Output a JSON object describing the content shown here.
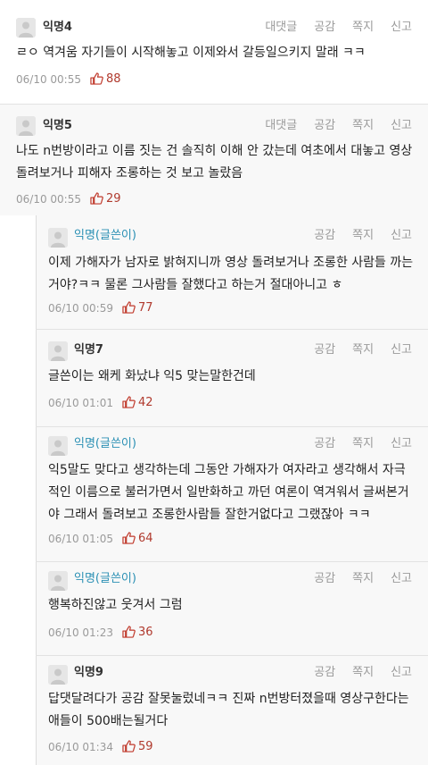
{
  "actions": {
    "reply": "대댓글",
    "like": "공감",
    "message": "쪽지",
    "report": "신고"
  },
  "colors": {
    "like": "#c0392b",
    "op_nick": "#2b90b4",
    "reply_bg": "#f8f8f8"
  },
  "icons": {
    "avatar": "default-avatar-icon",
    "like": "thumbs-up-icon"
  },
  "comments": [
    {
      "nick": "익명4",
      "text": "ㄹㅇ 역겨움 자기들이 시작해놓고 이제와서 갈등일으키지 말래 ㅋㅋ",
      "time": "06/10 00:55",
      "likes": "88"
    },
    {
      "nick": "익명5",
      "text": "나도 n번방이라고 이름 짓는 건 솔직히 이해 안 갔는데 여초에서 대놓고 영상 돌려보거나 피해자 조롱하는 것 보고 놀랐음",
      "time": "06/10 00:55",
      "likes": "29"
    },
    {
      "nick": "익명(글쓴이)",
      "text": "이제 가해자가 남자로 밝혀지니까 영상 돌려보거나 조롱한 사람들 까는거야?ㅋㅋ 물론 그사람들 잘했다고 하는거 절대아니고 ㅎ",
      "time": "06/10 00:59",
      "likes": "77"
    },
    {
      "nick": "익명7",
      "text": "글쓴이는 왜케 화났냐 익5 맞는말한건데",
      "time": "06/10 01:01",
      "likes": "42"
    },
    {
      "nick": "익명(글쓴이)",
      "text": "익5말도 맞다고 생각하는데 그동안 가해자가 여자라고 생각해서 자극적인 이름으로 불러가면서 일반화하고 까던 여론이 역겨워서 글써본거야 그래서 돌려보고 조롱한사람들 잘한거없다고 그랬잖아 ㅋㅋ",
      "time": "06/10 01:05",
      "likes": "64"
    },
    {
      "nick": "익명(글쓴이)",
      "text": "행복하진않고 웃겨서 그럼",
      "time": "06/10 01:23",
      "likes": "36"
    },
    {
      "nick": "익명9",
      "text": "답댓달려다가 공감 잘못눌렀네ㅋㅋ 진짜 n번방터졌을때 영상구한다는애들이 500배는될거다",
      "time": "06/10 01:34",
      "likes": "59"
    }
  ]
}
